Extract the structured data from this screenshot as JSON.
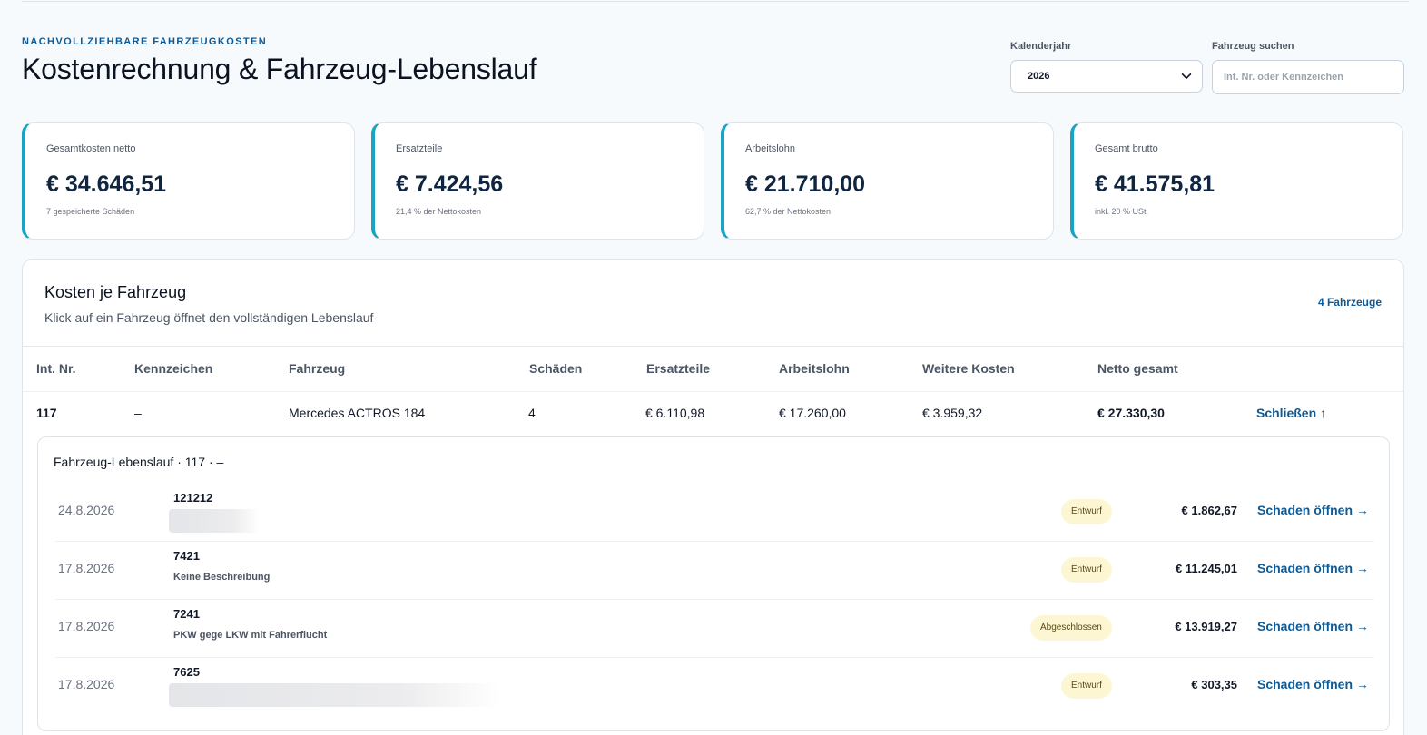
{
  "header": {
    "eyebrow": "NACHVOLLZIEHBARE FAHRZEUGKOSTEN",
    "title": "Kostenrechnung & Fahrzeug-Lebenslauf"
  },
  "filters": {
    "year_label": "Kalenderjahr",
    "year_value": "2026",
    "search_label": "Fahrzeug suchen",
    "search_placeholder": "Int. Nr. oder Kennzeichen"
  },
  "stats": [
    {
      "label": "Gesamtkosten netto",
      "value": "€ 34.646,51",
      "sub": "7 gespeicherte Schäden"
    },
    {
      "label": "Ersatzteile",
      "value": "€ 7.424,56",
      "sub": "21,4 % der Nettokosten"
    },
    {
      "label": "Arbeitslohn",
      "value": "€ 21.710,00",
      "sub": "62,7 % der Nettokosten"
    },
    {
      "label": "Gesamt brutto",
      "value": "€ 41.575,81",
      "sub": "inkl. 20 % USt."
    }
  ],
  "panel": {
    "title": "Kosten je Fahrzeug",
    "subtitle": "Klick auf ein Fahrzeug öffnet den vollständigen Lebenslauf",
    "count": "4 Fahrzeuge",
    "columns": [
      "Int. Nr.",
      "Kennzeichen",
      "Fahrzeug",
      "Schäden",
      "Ersatzteile",
      "Arbeitslohn",
      "Weitere Kosten",
      "Netto gesamt"
    ],
    "row": {
      "int_nr": "117",
      "kennzeichen": "–",
      "fahrzeug": "Mercedes ACTROS 184",
      "schaeden": "4",
      "ersatzteile": "€ 6.110,98",
      "arbeitslohn": "€ 17.260,00",
      "weitere": "€ 3.959,32",
      "netto": "€ 27.330,30",
      "close_label": "Schließen ↑"
    }
  },
  "lifecycle": {
    "title": "Fahrzeug-Lebenslauf · 117 · –",
    "open_label": "Schaden öffnen →",
    "entries": [
      {
        "date": "24.8.2026",
        "number": "121212",
        "description": "",
        "status": "Entwurf",
        "amount": "€ 1.862,67"
      },
      {
        "date": "17.8.2026",
        "number": "7421",
        "description": "Keine Beschreibung",
        "status": "Entwurf",
        "amount": "€ 11.245,01"
      },
      {
        "date": "17.8.2026",
        "number": "7241",
        "description": "PKW gege LKW mit Fahrerflucht",
        "status": "Abgeschlossen",
        "amount": "€ 13.919,27"
      },
      {
        "date": "17.8.2026",
        "number": "7625",
        "description": "",
        "status": "Entwurf",
        "amount": "€ 303,35"
      }
    ]
  }
}
